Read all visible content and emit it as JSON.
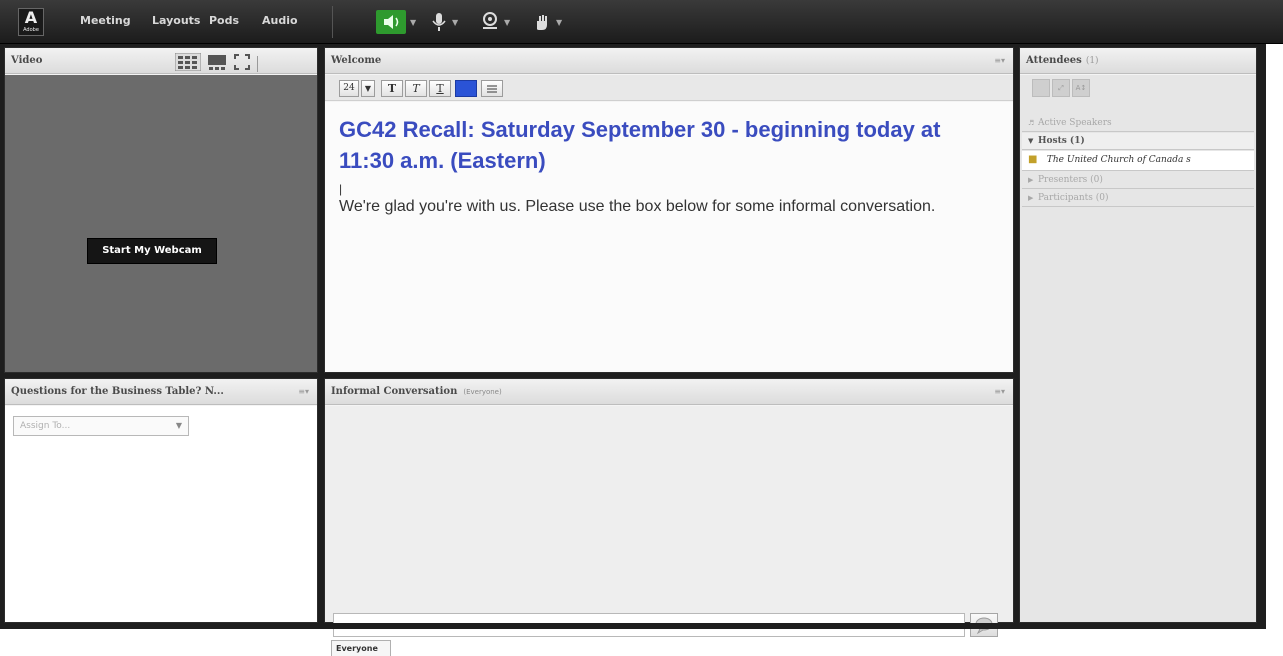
{
  "menubar": {
    "logo_label": "Adobe",
    "items": [
      "Meeting",
      "Layouts",
      "Pods",
      "Audio"
    ],
    "toolbar_icons": [
      "speaker-icon",
      "microphone-icon",
      "webcam-icon",
      "raise-hand-icon"
    ],
    "active_color": "#3fbf3f"
  },
  "video_pod": {
    "title": "Video",
    "webcam_button": "Start My Webcam"
  },
  "welcome_pod": {
    "title": "Welcome",
    "font_size": "24",
    "format_buttons": [
      "T",
      "T",
      "T"
    ],
    "heading": "GC42 Recall: Saturday September 30 - beginning today at 11:30 a.m. (Eastern)",
    "cursor": "|",
    "body": "We're glad you're with us. Please use the box below for some informal conversation.",
    "heading_color": "#3a4cbf"
  },
  "questions_pod": {
    "title": "Questions for the Business Table? N...",
    "select_placeholder": "Assign To..."
  },
  "chat_pod": {
    "title": "Informal Conversation",
    "audience": "(Everyone)",
    "input_value": "",
    "tab_label": "Everyone"
  },
  "attendees_pod": {
    "title": "Attendees",
    "count": "(1)",
    "active_speakers": "Active Speakers",
    "hosts": "Hosts (1)",
    "host_name": "The United Church of Canada s",
    "presenters": "Presenters (0)",
    "participants": "Participants (0)"
  }
}
